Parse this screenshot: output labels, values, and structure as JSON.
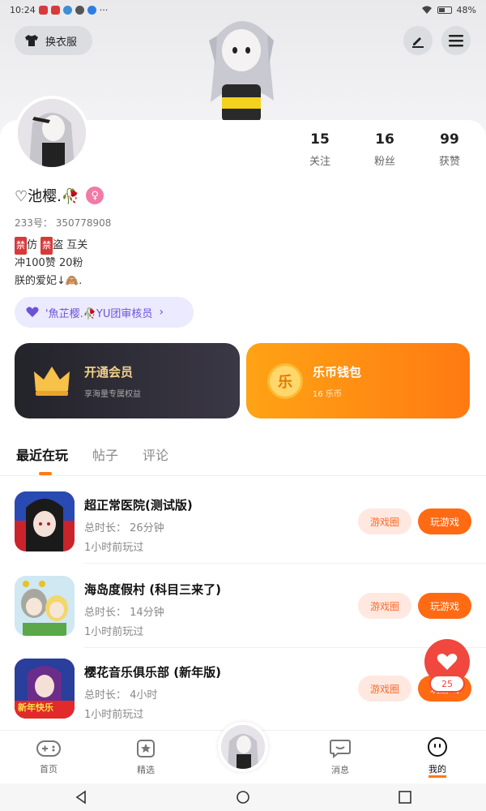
{
  "status_bar": {
    "time": "10:24",
    "dots": "···",
    "battery": "48%"
  },
  "header": {
    "wardrobe_label": "换衣服"
  },
  "profile": {
    "nickname": "♡池樱.🥀",
    "uid": "233号： 350778908",
    "bio_line1_ban1": "禁",
    "bio_line1_text1": "仿",
    "bio_line1_ban2": "禁",
    "bio_line1_text2": "盗 互关",
    "bio_line2": "冲100赞 20粉",
    "bio_line3": "朕的爱妃↓🙈.",
    "team_badge": "'魚芷樱.🥀YU团审核员",
    "stats": [
      {
        "num": "15",
        "label": "关注"
      },
      {
        "num": "16",
        "label": "粉丝"
      },
      {
        "num": "99",
        "label": "获赞"
      }
    ]
  },
  "cards": {
    "vip_title": "开通会员",
    "vip_sub": "享海量专属权益",
    "wallet_title": "乐币钱包",
    "wallet_sub": "16 乐币",
    "wallet_coin": "乐"
  },
  "tabs": [
    "最近在玩",
    "帖子",
    "评论"
  ],
  "games": [
    {
      "name": "超正常医院(测试版)",
      "duration": "总时长： 26分钟",
      "last": "1小时前玩过",
      "circle_btn": "游戏圈",
      "play_btn": "玩游戏"
    },
    {
      "name": "海岛度假村 (科目三来了)",
      "duration": "总时长： 14分钟",
      "last": "1小时前玩过",
      "circle_btn": "游戏圈",
      "play_btn": "玩游戏"
    },
    {
      "name": "樱花音乐俱乐部 (新年版)",
      "duration": "总时长： 4小时",
      "last": "1小时前玩过",
      "circle_btn": "游戏圈",
      "play_btn": "玩游戏",
      "icon_text": "新年快乐"
    }
  ],
  "like": {
    "count": "25"
  },
  "bottom_nav": [
    {
      "label": "首页",
      "icon": "gamepad-icon"
    },
    {
      "label": "精选",
      "icon": "star-icon"
    },
    {
      "label": "消息",
      "icon": "message-icon"
    },
    {
      "label": "我的",
      "icon": "face-icon"
    }
  ],
  "colors": {
    "accent": "#ff6a12",
    "like": "#f0473e",
    "vip_text": "#f5d28a",
    "badge": "#6b52d9"
  }
}
